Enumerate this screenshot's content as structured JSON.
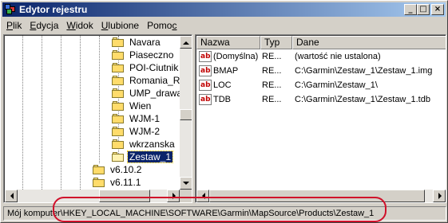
{
  "window": {
    "title": "Edytor rejestru"
  },
  "titlebar_buttons": {
    "minimize": "_",
    "maximize": "□",
    "close": "×"
  },
  "menu": [
    {
      "label": "Plik",
      "underline": "P",
      "rest": "lik"
    },
    {
      "label": "Edycja",
      "underline": "E",
      "rest": "dycja"
    },
    {
      "label": "Widok",
      "underline": "W",
      "rest": "idok"
    },
    {
      "label": "Ulubione",
      "underline": "U",
      "rest": "lubione"
    },
    {
      "label": "Pomoc",
      "underline": "",
      "pre": "Pomo",
      "underline2": "c"
    }
  ],
  "tree": {
    "items": [
      {
        "label": "Navara"
      },
      {
        "label": "Piaseczno"
      },
      {
        "label": "POI-Ciutnik"
      },
      {
        "label": "Romania_Ro"
      },
      {
        "label": "UMP_drawa"
      },
      {
        "label": "Wien"
      },
      {
        "label": "WJM-1"
      },
      {
        "label": "WJM-2"
      },
      {
        "label": "wkrzanska"
      },
      {
        "label": "Zestaw_1",
        "selected": true
      }
    ],
    "siblings": [
      {
        "label": "v6.10.2"
      },
      {
        "label": "v6.11.1"
      }
    ]
  },
  "list": {
    "columns": [
      {
        "label": "Nazwa"
      },
      {
        "label": "Typ"
      },
      {
        "label": "Dane"
      }
    ],
    "rows": [
      {
        "name": "(Domyślna)",
        "type": "RE...",
        "data": "(wartość nie ustalona)"
      },
      {
        "name": "BMAP",
        "type": "RE...",
        "data": "C:\\Garmin\\Zestaw_1\\Zestaw_1.img"
      },
      {
        "name": "LOC",
        "type": "RE...",
        "data": "C:\\Garmin\\Zestaw_1\\"
      },
      {
        "name": "TDB",
        "type": "RE...",
        "data": "C:\\Garmin\\Zestaw_1\\Zestaw_1.tdb"
      }
    ],
    "icon_text": "ab"
  },
  "status": {
    "path": "Mój komputer\\HKEY_LOCAL_MACHINE\\SOFTWARE\\Garmin\\MapSource\\Products\\Zestaw_1"
  },
  "colors": {
    "titlebar_start": "#0a246a",
    "titlebar_end": "#a6caf0",
    "selection": "#0a246a",
    "annotation": "#d0102a"
  }
}
